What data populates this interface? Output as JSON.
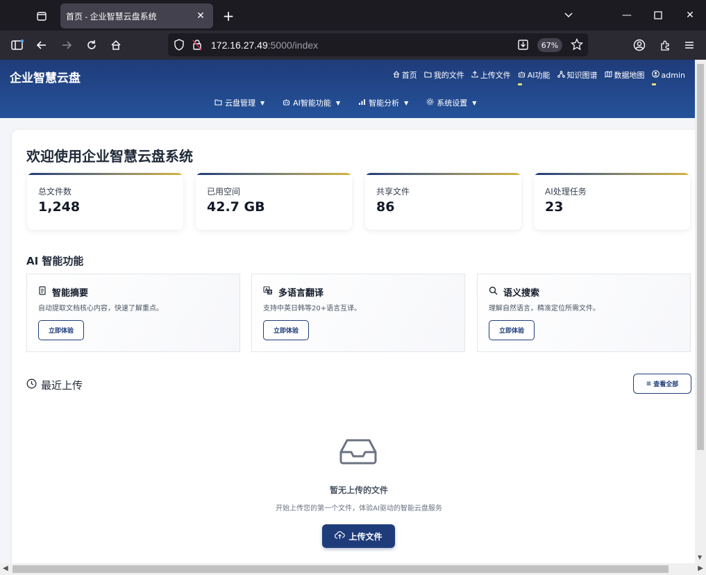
{
  "browser": {
    "tab_title": "首页 - 企业智慧云盘系统",
    "url_host": "172.16.27.49",
    "url_rest": ":5000/index",
    "zoom": "67%"
  },
  "header": {
    "brand": "企业智慧云盘",
    "links": [
      {
        "label": "首页",
        "icon": "home-icon"
      },
      {
        "label": "我的文件",
        "icon": "folder-icon"
      },
      {
        "label": "上传文件",
        "icon": "upload-icon"
      },
      {
        "label": "AI功能",
        "icon": "robot-icon"
      },
      {
        "label": "知识图谱",
        "icon": "graph-icon"
      },
      {
        "label": "数据地图",
        "icon": "map-icon"
      },
      {
        "label": "admin",
        "icon": "user-icon"
      }
    ],
    "menu": [
      {
        "label": "云盘管理",
        "icon": "folder-icon"
      },
      {
        "label": "AI智能功能",
        "icon": "robot-icon"
      },
      {
        "label": "智能分析",
        "icon": "chart-icon"
      },
      {
        "label": "系统设置",
        "icon": "gear-icon"
      }
    ]
  },
  "main": {
    "title": "欢迎使用企业智慧云盘系统",
    "stats": [
      {
        "label": "总文件数",
        "value": "1,248"
      },
      {
        "label": "已用空间",
        "value": "42.7 GB"
      },
      {
        "label": "共享文件",
        "value": "86"
      },
      {
        "label": "AI处理任务",
        "value": "23"
      }
    ],
    "ai_section_title": "AI 智能功能",
    "features": [
      {
        "title": "智能摘要",
        "desc": "自动提取文档核心内容，快速了解重点。",
        "button": "立即体验",
        "icon": "document-icon"
      },
      {
        "title": "多语言翻译",
        "desc": "支持中英日韩等20+语言互译。",
        "button": "立即体验",
        "icon": "translate-icon"
      },
      {
        "title": "语义搜索",
        "desc": "理解自然语言，精准定位所需文件。",
        "button": "立即体验",
        "icon": "search-icon"
      }
    ],
    "recent_title": "最近上传",
    "view_all": "查看全部",
    "empty_title": "暂无上传的文件",
    "empty_desc": "开始上传您的第一个文件，体验AI驱动的智能云盘服务",
    "upload_button": "上传文件"
  }
}
